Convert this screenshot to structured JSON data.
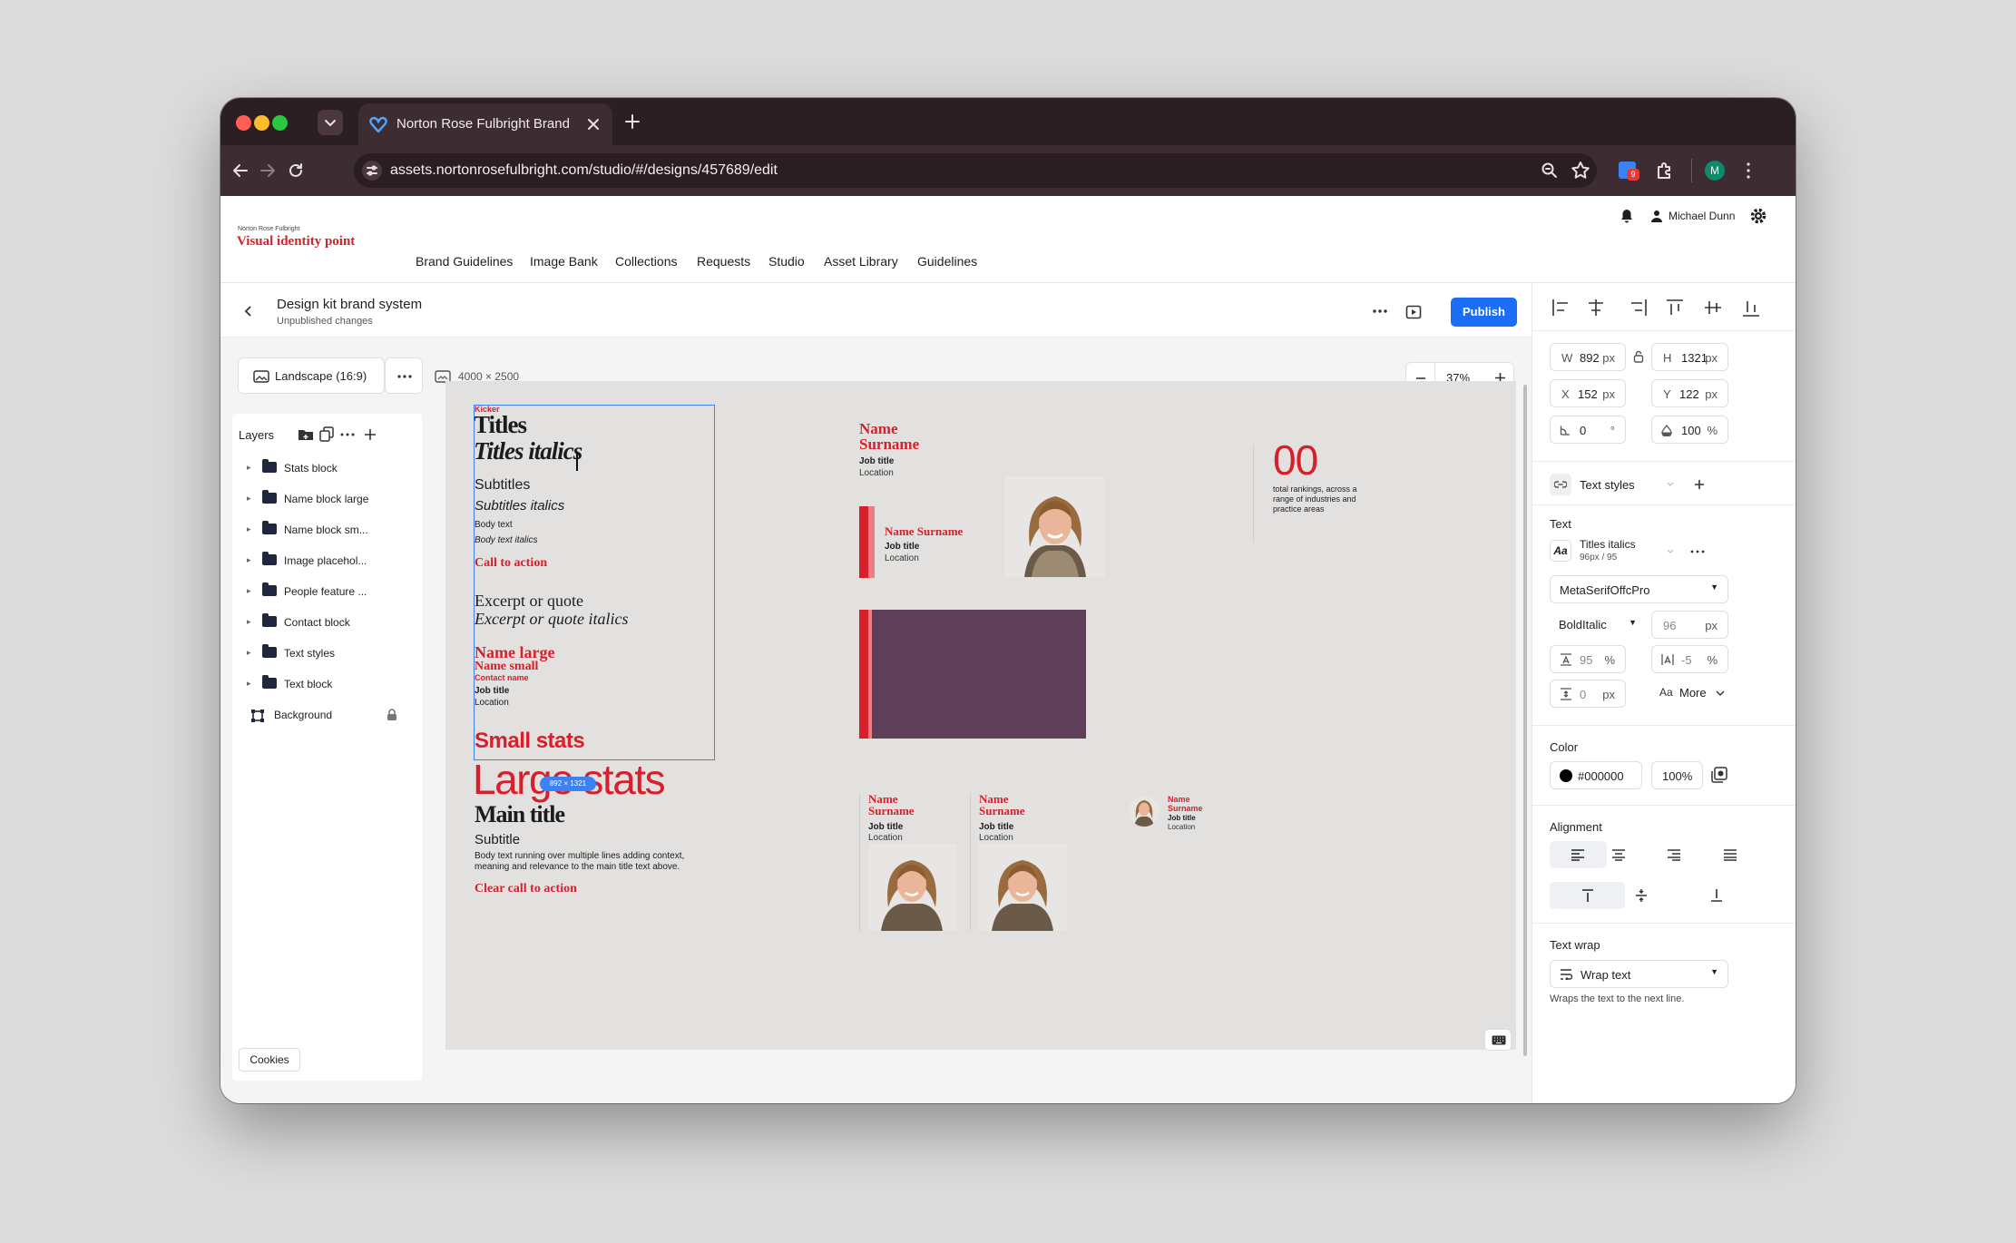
{
  "browser": {
    "tab_title": "Norton Rose Fulbright Brand",
    "url": "assets.nortonrosefulbright.com/studio/#/designs/457689/edit",
    "extension_badge": "9",
    "profile_initial": "M"
  },
  "site": {
    "logo_small": "Norton Rose Fulbright",
    "logo_main": "Visual identity point",
    "user_name": "Michael Dunn",
    "nav": [
      "Brand Guidelines",
      "Image Bank",
      "Collections",
      "Requests",
      "Studio",
      "Asset Library",
      "Guidelines"
    ]
  },
  "editor": {
    "design_title": "Design kit brand system",
    "status": "Unpublished changes",
    "publish_label": "Publish",
    "format_label": "Landscape (16:9)",
    "canvas_size": "4000 × 2500",
    "zoom": "37%",
    "selection_badge": "892 × 1321",
    "cookies_label": "Cookies"
  },
  "layers": {
    "title": "Layers",
    "items": [
      "Stats block",
      "Name block large",
      "Name block sm...",
      "Image placehol...",
      "People feature ...",
      "Contact block",
      "Text styles",
      "Text block"
    ],
    "background_label": "Background"
  },
  "canvas": {
    "kicker": "Kicker",
    "titles": "Titles",
    "titles_italics": "Titles italics",
    "subtitles": "Subtitles",
    "subtitles_italics": "Subtitles italics",
    "body_text": "Body text",
    "body_text_italics": "Body text italics",
    "call_to_action": "Call to action",
    "excerpt": "Excerpt or quote",
    "excerpt_italics": "Excerpt or quote italics",
    "name_large": "Name large",
    "name_small": "Name small",
    "contact_name": "Contact name",
    "job_title": "Job title",
    "location": "Location",
    "small_stats": "Small stats",
    "large_stats": "Large stats",
    "main_title": "Main title",
    "subtitle": "Subtitle",
    "body_long": "Body text running over multiple lines adding context, meaning and relevance to the main title text above.",
    "clear_cta": "Clear call to action",
    "name": "Name",
    "surname": "Surname",
    "name_surname": "Name Surname",
    "stat_number": "00",
    "stat_text": "total rankings, across a range of industries and practice areas"
  },
  "properties": {
    "w_label": "W",
    "w_value": "892",
    "h_label": "H",
    "h_value": "1321",
    "x_label": "X",
    "x_value": "152",
    "y_label": "Y",
    "y_value": "122",
    "unit_px": "px",
    "rotation": "0",
    "rotation_unit": "°",
    "opacity": "100",
    "percent": "%",
    "text_styles_label": "Text styles",
    "text_section": "Text",
    "style_name": "Titles italics",
    "style_meta": "96px / 95",
    "font_family": "MetaSerifOffcPro",
    "font_weight": "BoldItalic",
    "font_size": "96",
    "line_height": "95",
    "letter_spacing": "-5",
    "paragraph_spacing": "0",
    "more_label": "More",
    "color_section": "Color",
    "color_hex": "#000000",
    "color_opacity": "100%",
    "alignment_section": "Alignment",
    "text_wrap_section": "Text wrap",
    "wrap_option": "Wrap text",
    "wrap_help": "Wraps the text to the next line."
  },
  "colors": {
    "brand_red": "#d6202c",
    "publish_blue": "#1a6ef5",
    "purple_block": "#5e3e58",
    "selection_blue": "#3b82f6"
  }
}
